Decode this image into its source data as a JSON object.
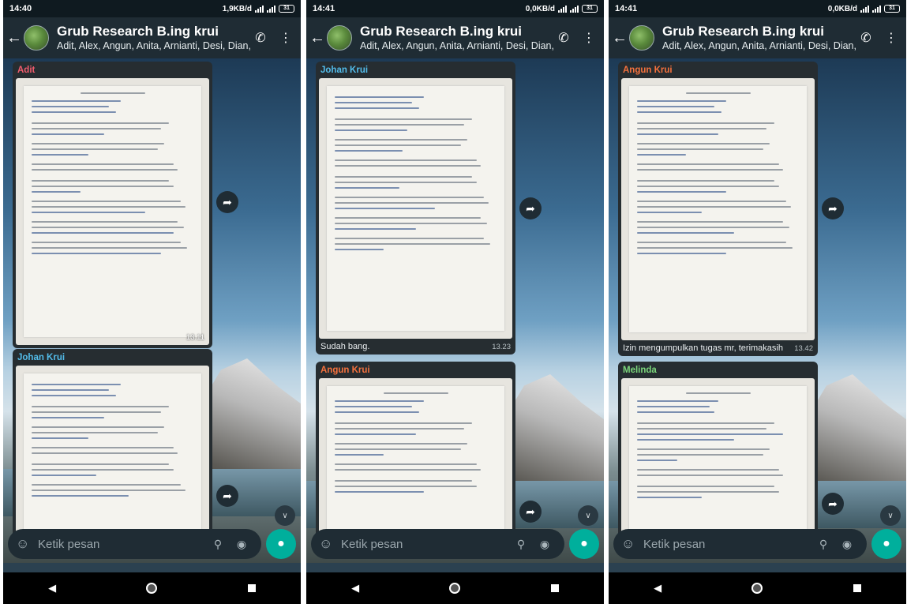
{
  "colors": {
    "sender_adit": "#f15c6d",
    "sender_johan": "#53bdeb",
    "sender_angun": "#f5713d",
    "sender_melinda": "#7bd67b",
    "mic_button": "#00af9c"
  },
  "placeholder": "Ketik pesan",
  "screens": [
    {
      "status": {
        "time": "14:40",
        "net": "1,9KB/d",
        "battery": "31"
      },
      "chat": {
        "title": "Grub Research B.ing krui",
        "members": "Adit, Alex, Angun, Anita, Arnianti, Desi, Dian, Enti..."
      },
      "messages": [
        {
          "sender": "Adit",
          "time": "13.11"
        },
        {
          "sender": "Johan Krui"
        }
      ]
    },
    {
      "status": {
        "time": "14:41",
        "net": "0,0KB/d",
        "battery": "31"
      },
      "chat": {
        "title": "Grub Research B.ing krui",
        "members": "Adit, Alex, Angun, Anita, Arnianti, Desi, Dian, Enti..."
      },
      "messages": [
        {
          "sender": "Johan Krui",
          "caption": "Sudah bang.",
          "time": "13.23"
        },
        {
          "sender": "Angun Krui"
        }
      ]
    },
    {
      "status": {
        "time": "14:41",
        "net": "0,0KB/d",
        "battery": "31"
      },
      "chat": {
        "title": "Grub Research B.ing krui",
        "members": "Adit, Alex, Angun, Anita, Arnianti, Desi, Dian, Enti..."
      },
      "messages": [
        {
          "sender": "Angun Krui",
          "caption": "Izin mengumpulkan tugas mr, terimakasih",
          "time": "13.42"
        },
        {
          "sender": "Melinda"
        }
      ]
    }
  ]
}
